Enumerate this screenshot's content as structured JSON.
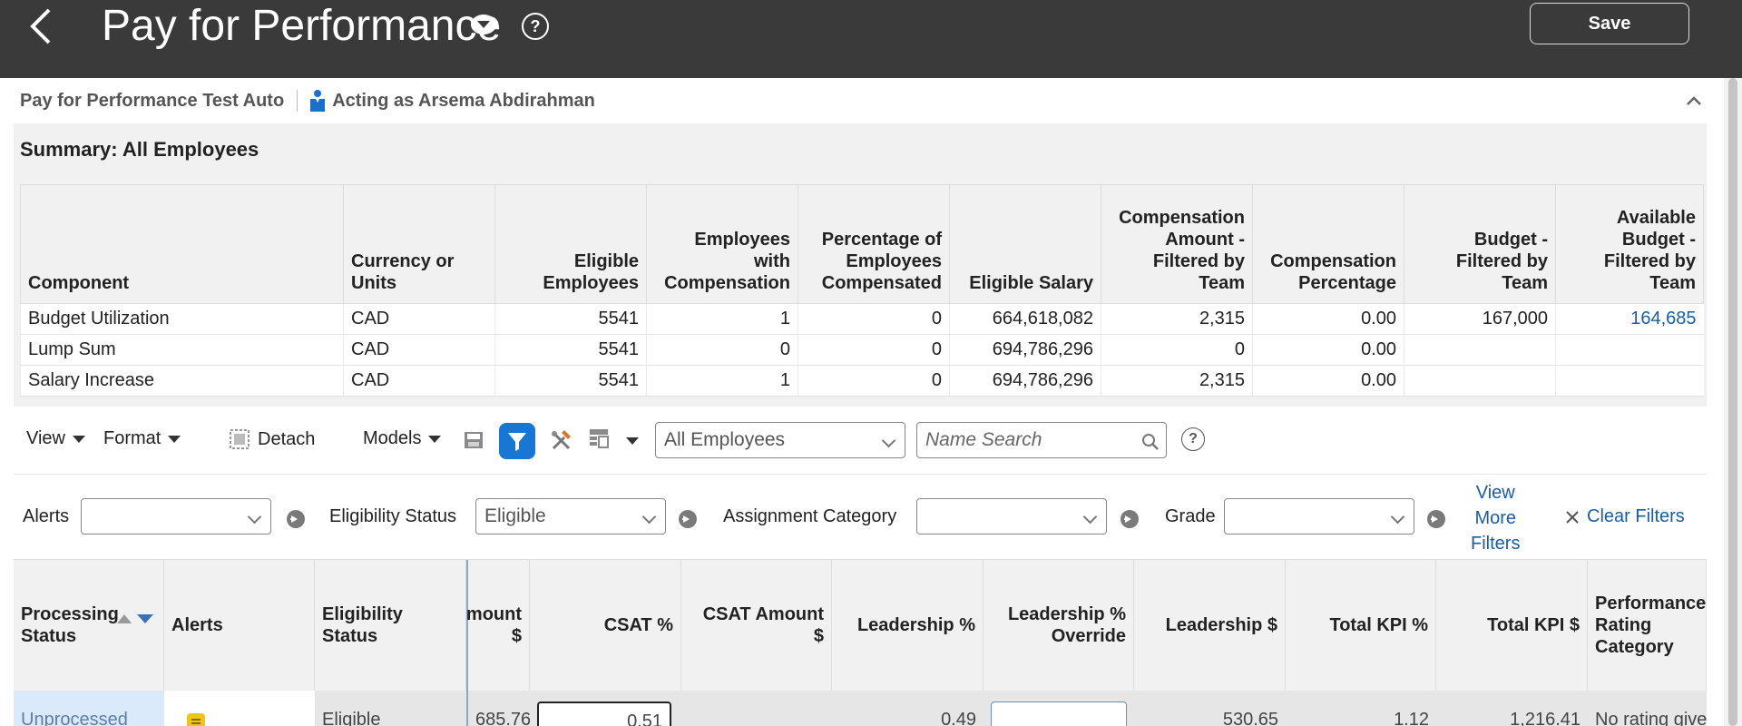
{
  "header": {
    "title": "Pay for Performance",
    "save_label": "Save"
  },
  "context": {
    "plan_name": "Pay for Performance Test Auto",
    "acting_as": "Acting as Arsema Abdirahman"
  },
  "summary": {
    "title": "Summary: All Employees",
    "columns": [
      "Component",
      "Currency or Units",
      "Eligible Employees",
      "Employees with Compensation",
      "Percentage of Employees Compensated",
      "Eligible Salary",
      "Compensation Amount - Filtered by Team",
      "Compensation Percentage",
      "Budget - Filtered by Team",
      "Available Budget - Filtered by Team"
    ],
    "rows": [
      [
        "Budget Utilization",
        "CAD",
        "5541",
        "1",
        "0",
        "664,618,082",
        "2,315",
        "0.00",
        "167,000",
        "164,685"
      ],
      [
        "Lump Sum",
        "CAD",
        "5541",
        "0",
        "0",
        "694,786,296",
        "0",
        "0.00",
        "",
        ""
      ],
      [
        "Salary Increase",
        "CAD",
        "5541",
        "1",
        "0",
        "694,786,296",
        "2,315",
        "0.00",
        "",
        ""
      ]
    ]
  },
  "toolbar": {
    "view_label": "View",
    "format_label": "Format",
    "detach_label": "Detach",
    "models_label": "Models",
    "population_value": "All Employees",
    "name_search_placeholder": "Name Search"
  },
  "filters": {
    "alerts_label": "Alerts",
    "alerts_value": "",
    "eligibility_label": "Eligibility Status",
    "eligibility_value": "Eligible",
    "assignment_label": "Assignment Category",
    "assignment_value": "",
    "grade_label": "Grade",
    "grade_value": "",
    "view_more_line1": "View",
    "view_more_line2": "More",
    "view_more_line3": "Filters",
    "clear_filters_label": "Clear Filters"
  },
  "grid": {
    "columns": [
      "Processing Status",
      "Alerts",
      "Eligibility Status",
      "mount $",
      "CSAT %",
      "CSAT Amount $",
      "Leadership %",
      "Leadership % Override",
      "Leadership $",
      "Total KPI %",
      "Total KPI $",
      "Performance Rating Category"
    ],
    "row": {
      "processing_status": "Unprocessed",
      "eligibility_status": "Eligible",
      "amount": "685.76",
      "csat_percent": "0.51",
      "csat_amount": "",
      "leadership_percent": "0.49",
      "leadership_override": "",
      "leadership_amount": "530.65",
      "total_kpi_percent": "1.12",
      "total_kpi_amount": "1,216.41",
      "rating_category": "No rating give"
    }
  },
  "colors": {
    "header_bg": "#3a3a3a",
    "link": "#1a5ea0",
    "filter_active": "#1877d2",
    "row_selected": "#dbeafa"
  }
}
